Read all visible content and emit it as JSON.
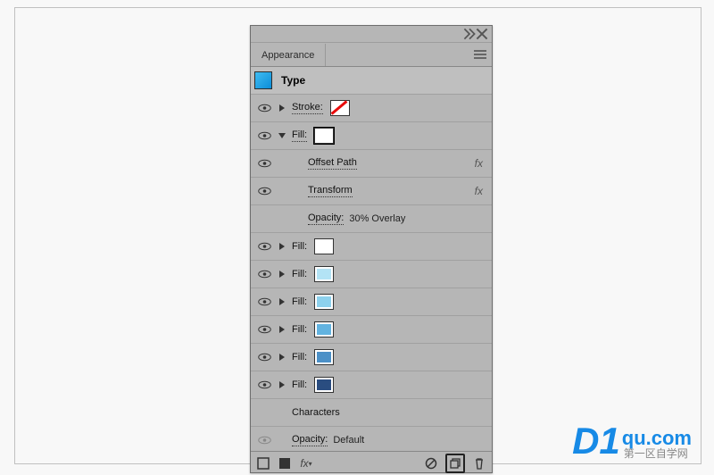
{
  "panel": {
    "tab_label": "Appearance",
    "header_title": "Type",
    "characters_label": "Characters"
  },
  "rows": [
    {
      "label": "Stroke:",
      "swatch": "none",
      "arrow": "right",
      "dotted": true
    },
    {
      "label": "Fill:",
      "swatch": "#ffffff",
      "arrow": "down",
      "dotted": true
    },
    {
      "label": "Offset Path",
      "fx": true,
      "indent": 2,
      "dotted": true
    },
    {
      "label": "Transform",
      "fx": true,
      "indent": 2,
      "dotted": true
    },
    {
      "label": "Opacity:",
      "value": "30% Overlay",
      "indent": 2,
      "dotted": true
    },
    {
      "label": "Fill:",
      "swatch": "#ffffff",
      "arrow": "right",
      "dotted": false
    },
    {
      "label": "Fill:",
      "swatch": "#b3e3f5",
      "arrow": "right",
      "dotted": false
    },
    {
      "label": "Fill:",
      "swatch": "#8dd1ed",
      "arrow": "right",
      "dotted": false
    },
    {
      "label": "Fill:",
      "swatch": "#62b3e0",
      "arrow": "right",
      "dotted": false
    },
    {
      "label": "Fill:",
      "swatch": "#4b90c7",
      "arrow": "right",
      "dotted": false
    },
    {
      "label": "Fill:",
      "swatch": "#2a4d80",
      "arrow": "right",
      "dotted": false
    }
  ],
  "opacity_row": {
    "label": "Opacity:",
    "value": "Default",
    "dim": true
  },
  "watermark": {
    "d1": "D1",
    "domain": "qu.com",
    "sub": "第一区自学网"
  }
}
